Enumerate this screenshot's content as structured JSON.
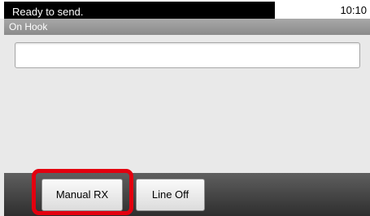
{
  "status_bar": {
    "message": "Ready to send.",
    "time": "10:10"
  },
  "header": {
    "title": "On Hook"
  },
  "number_field": {
    "value": ""
  },
  "soft_keys": {
    "manual_rx_label": "Manual RX",
    "line_off_label": "Line Off"
  },
  "colors": {
    "highlight": "#e3000f",
    "header": "#9a9a9a",
    "bottom_bar": "#3f3f3f"
  }
}
